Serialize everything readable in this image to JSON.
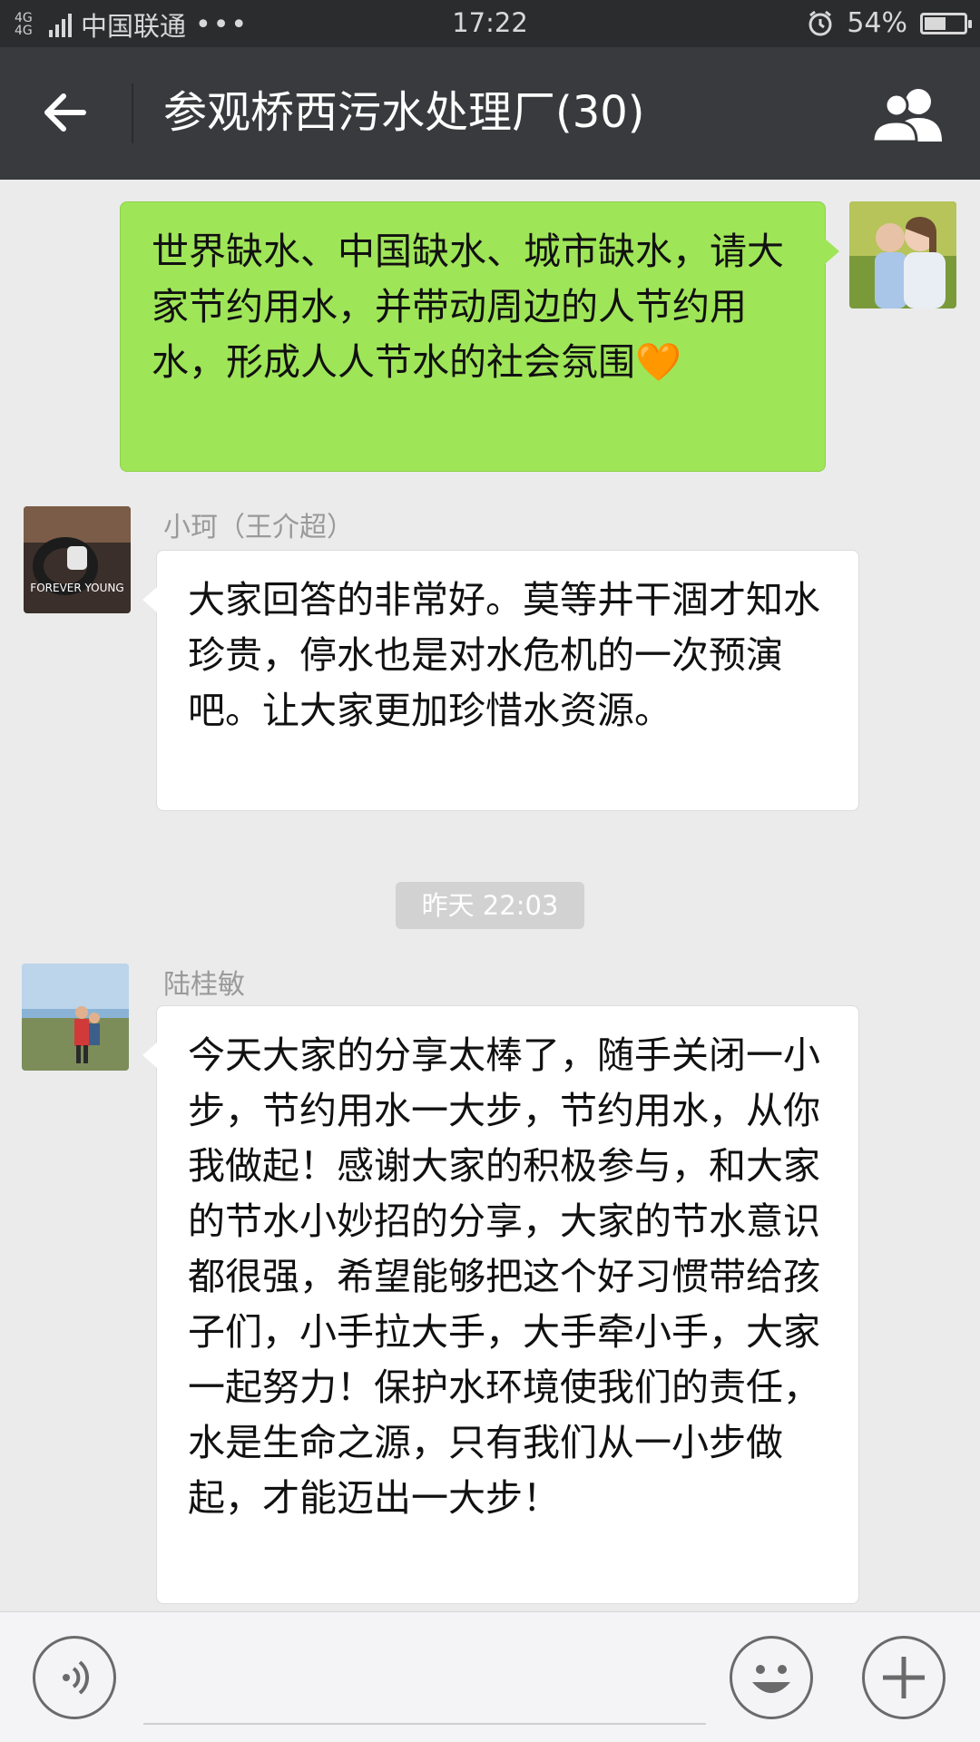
{
  "status_bar": {
    "network": "4G 4G",
    "carrier": "中国联通",
    "more": "•••",
    "time": "17:22",
    "battery_percent": "54%",
    "battery_level": 0.54
  },
  "header": {
    "title": "参观桥西污水处理厂(30)",
    "back_icon": "arrow-left-icon",
    "members_icon": "group-members-icon"
  },
  "messages": [
    {
      "side": "right",
      "sender": "",
      "text": "世界缺水、中国缺水、城市缺水，请大家节约用水，并带动周边的人节约用水，形成人人节水的社会氛围",
      "emoji": "🧡"
    },
    {
      "side": "left",
      "sender": "小珂（王介超）",
      "avatar_text": "FOREVER YOUNG",
      "text": "大家回答的非常好。莫等井干涸才知水珍贵，停水也是对水危机的一次预演吧。让大家更加珍惜水资源。"
    },
    {
      "time_divider": "昨天 22:03"
    },
    {
      "side": "left",
      "sender": "陆桂敏",
      "text": "今天大家的分享太棒了，随手关闭一小步，节约用水一大步，节约用水，从你我做起！感谢大家的积极参与，和大家的节水小妙招的分享，大家的节水意识都很强，希望能够把这个好习惯带给孩子们，小手拉大手，大手牵小手，大家一起努力！保护水环境使我们的责任，水是生命之源，只有我们从一小步做起，才能迈出一大步！"
    }
  ],
  "input_bar": {
    "voice_icon": "voice-icon",
    "emoji_icon": "emoji-icon",
    "plus_icon": "plus-icon",
    "placeholder": ""
  },
  "colors": {
    "title_bar": "#383a3d",
    "status_bar": "#2b2c2e",
    "chat_bg": "#ebebeb",
    "own_bubble": "#9fe558",
    "other_bubble": "#ffffff"
  }
}
